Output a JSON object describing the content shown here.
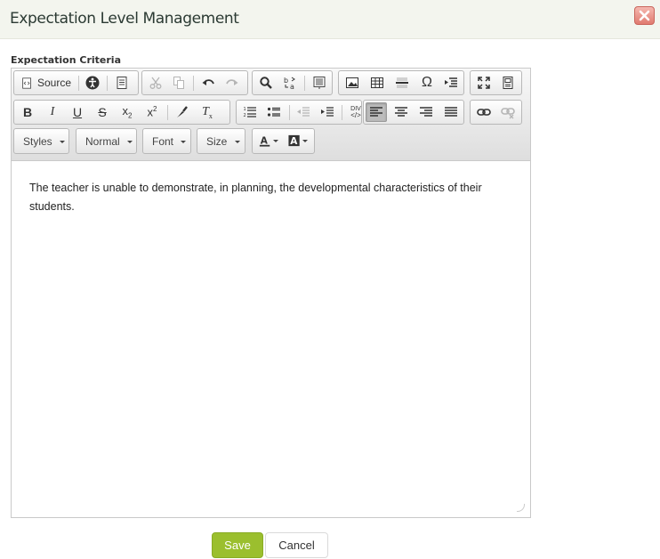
{
  "dialog": {
    "title": "Expectation Level Management",
    "close_icon": "close-icon"
  },
  "field": {
    "label": "Expectation Criteria"
  },
  "toolbar": {
    "source_label": "Source",
    "styles_label": "Styles",
    "format_label": "Normal",
    "font_label": "Font",
    "size_label": "Size",
    "div_label": "DIV"
  },
  "editor": {
    "content": "The teacher is unable to demonstrate, in planning, the developmental characteristics of their students."
  },
  "actions": {
    "save_label": "Save",
    "cancel_label": "Cancel",
    "save_color": "#9bbf2e"
  }
}
